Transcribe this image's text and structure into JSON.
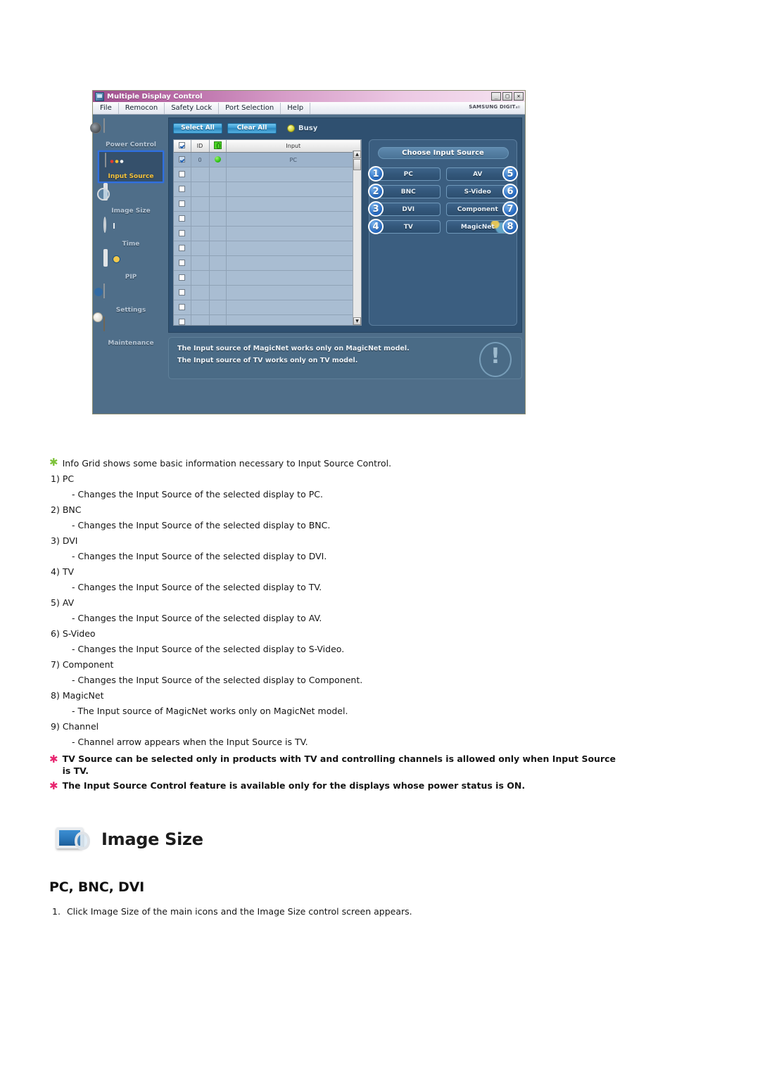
{
  "app": {
    "title": "Multiple Display Control",
    "window_buttons": [
      {
        "name": "minimize",
        "glyph": "_"
      },
      {
        "name": "maximize",
        "glyph": "□"
      },
      {
        "name": "close",
        "glyph": "✕"
      }
    ],
    "menu": [
      "File",
      "Remocon",
      "Safety Lock",
      "Port Selection",
      "Help"
    ],
    "brand": "SAMSUNG DIGIT",
    "brand_sub": "all",
    "sidebar": [
      {
        "label": "Power Control",
        "icon": "camera-icon",
        "active": false
      },
      {
        "label": "Input Source",
        "icon": "input-box-icon",
        "active": true
      },
      {
        "label": "Image Size",
        "icon": "monitor-magnifier-icon",
        "active": false
      },
      {
        "label": "Time",
        "icon": "clock-icon",
        "active": false
      },
      {
        "label": "PIP",
        "icon": "pip-monitor-icon",
        "active": false
      },
      {
        "label": "Settings",
        "icon": "cube-settings-icon",
        "active": false
      },
      {
        "label": "Maintenance",
        "icon": "maintenance-icon",
        "active": false
      }
    ],
    "toolbar": {
      "select_all": "Select All",
      "clear_all": "Clear All",
      "busy_label": "Busy"
    },
    "grid": {
      "headers": [
        "",
        "ID",
        "",
        "Input"
      ],
      "rows": [
        {
          "checked": true,
          "id": "0",
          "power": true,
          "input": "PC"
        },
        {
          "checked": false,
          "id": "",
          "power": false,
          "input": ""
        },
        {
          "checked": false,
          "id": "",
          "power": false,
          "input": ""
        },
        {
          "checked": false,
          "id": "",
          "power": false,
          "input": ""
        },
        {
          "checked": false,
          "id": "",
          "power": false,
          "input": ""
        },
        {
          "checked": false,
          "id": "",
          "power": false,
          "input": ""
        },
        {
          "checked": false,
          "id": "",
          "power": false,
          "input": ""
        },
        {
          "checked": false,
          "id": "",
          "power": false,
          "input": ""
        },
        {
          "checked": false,
          "id": "",
          "power": false,
          "input": ""
        },
        {
          "checked": false,
          "id": "",
          "power": false,
          "input": ""
        },
        {
          "checked": false,
          "id": "",
          "power": false,
          "input": ""
        },
        {
          "checked": false,
          "id": "",
          "power": false,
          "input": ""
        },
        {
          "checked": false,
          "id": "",
          "power": false,
          "input": ""
        }
      ]
    },
    "source_panel": {
      "title": "Choose Input Source",
      "buttons": [
        {
          "label": "PC",
          "badge": "1",
          "side": "left"
        },
        {
          "label": "AV",
          "badge": "5",
          "side": "right"
        },
        {
          "label": "BNC",
          "badge": "2",
          "side": "left"
        },
        {
          "label": "S-Video",
          "badge": "6",
          "side": "right"
        },
        {
          "label": "DVI",
          "badge": "3",
          "side": "left"
        },
        {
          "label": "Component",
          "badge": "7",
          "side": "right"
        },
        {
          "label": "TV",
          "badge": "4",
          "side": "left"
        },
        {
          "label": "MagicNet",
          "badge": "8",
          "side": "right"
        }
      ]
    },
    "notes": [
      "The Input source of MagicNet works only on MagicNet model.",
      "The Input source of TV works only on TV  model."
    ]
  },
  "doc": {
    "intro": "Info Grid shows some basic information necessary to Input Source Control.",
    "items": [
      {
        "num": "1)",
        "title": "PC",
        "desc": "- Changes the Input Source of the selected display to PC."
      },
      {
        "num": "2)",
        "title": "BNC",
        "desc": "- Changes the Input Source of the selected display to BNC."
      },
      {
        "num": "3)",
        "title": "DVI",
        "desc": "- Changes the Input Source of the selected display to DVI."
      },
      {
        "num": "4)",
        "title": "TV",
        "desc": "- Changes the Input Source of the selected display to TV."
      },
      {
        "num": "5)",
        "title": "AV",
        "desc": "- Changes the Input Source of the selected display to AV."
      },
      {
        "num": "6)",
        "title": "S-Video",
        "desc": "- Changes the Input Source of the selected display to S-Video."
      },
      {
        "num": "7)",
        "title": "Component",
        "desc": "- Changes the Input Source of the selected display to Component."
      },
      {
        "num": "8)",
        "title": "MagicNet",
        "desc": "- The Input source of MagicNet works only on MagicNet model."
      },
      {
        "num": "9)",
        "title": "Channel",
        "desc": "- Channel arrow appears when the Input Source is TV."
      }
    ],
    "bold_notes": [
      "TV Source can be selected only in products with TV and controlling channels is allowed only when Input Source is TV.",
      "The Input Source Control feature is available only for the displays whose power status is ON."
    ],
    "section_title": "Image Size",
    "sub_heading": "PC, BNC, DVI",
    "step_num": "1.",
    "step_text": "Click Image Size of the main icons and the Image Size control screen appears."
  },
  "colors": {
    "app_bg": "#4f6e89",
    "panel_bg": "#2f5070",
    "accent_blue": "#2a6ec4",
    "active_label": "#f5c13a",
    "green_star": "#7dc23a",
    "pink_star": "#e8256f"
  }
}
